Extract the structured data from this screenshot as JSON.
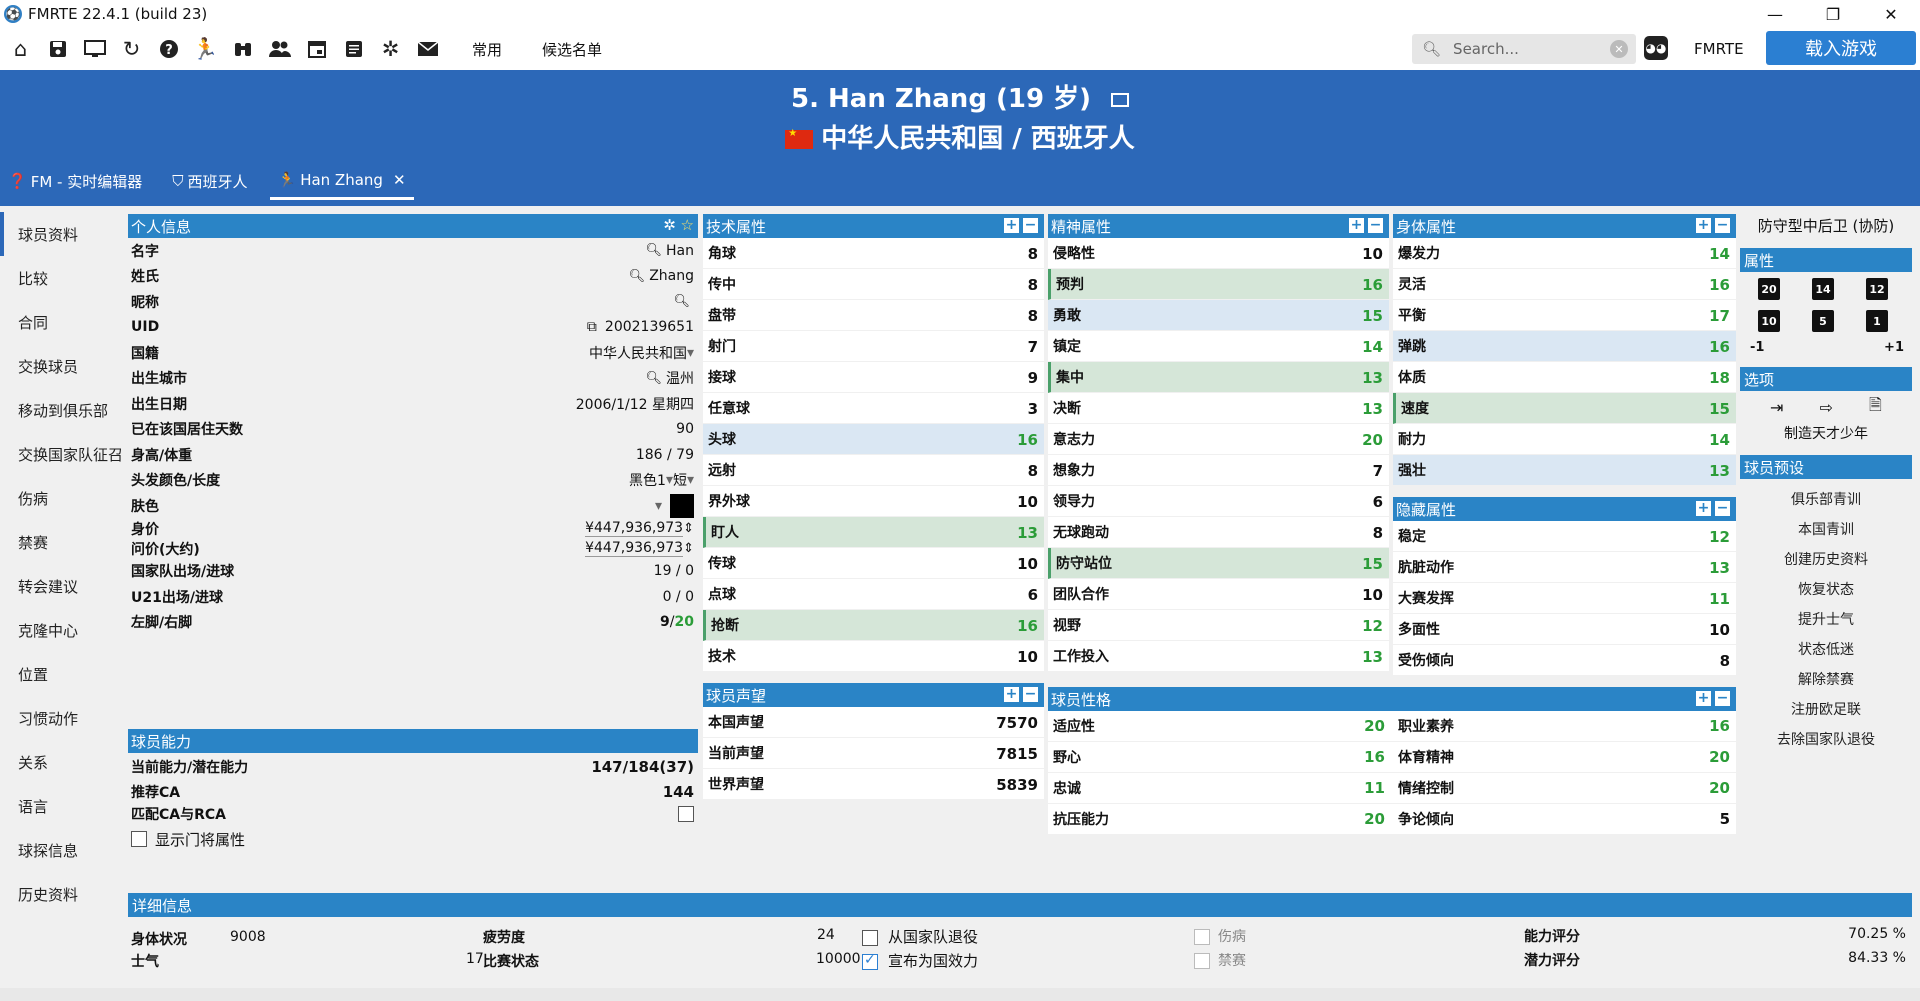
{
  "window": {
    "title": "FMRTE 22.4.1 (build 23)",
    "minimize": "—",
    "maximize": "❐",
    "close": "✕"
  },
  "toolbar": {
    "icons": [
      "home-icon",
      "save-icon",
      "monitor-icon",
      "refresh-icon",
      "help-icon",
      "player-icon",
      "binoculars-icon",
      "people-icon",
      "calendar-icon",
      "document-icon",
      "settings-icon",
      "mail-icon"
    ],
    "menu_common": "常用",
    "menu_shortlist": "候选名单",
    "search_placeholder": "Search...",
    "fmrte_label": "FMRTE",
    "load_game": "载入游戏"
  },
  "header": {
    "player_title": "5. Han Zhang (19 岁)",
    "nationality": "中华人民共和国 / 西班牙人"
  },
  "tabs": [
    {
      "label": "FM - 实时编辑器"
    },
    {
      "label": "西班牙人"
    },
    {
      "label": "Han Zhang"
    }
  ],
  "sidebar": [
    "球员资料",
    "比较",
    "合同",
    "交换球员",
    "移动到俱乐部",
    "交换国家队征召",
    "伤病",
    "禁赛",
    "转会建议",
    "克隆中心",
    "位置",
    "习惯动作",
    "关系",
    "语言",
    "球探信息",
    "历史资料"
  ],
  "personal": {
    "title": "个人信息",
    "rows": [
      {
        "label": "名字",
        "value": "Han"
      },
      {
        "label": "姓氏",
        "value": "Zhang"
      },
      {
        "label": "昵称",
        "value": ""
      },
      {
        "label": "UID",
        "value": "2002139651"
      },
      {
        "label": "国籍",
        "value": "中华人民共和国"
      },
      {
        "label": "出生城市",
        "value": "温州"
      },
      {
        "label": "出生日期",
        "value": "2006/1/12 星期四"
      },
      {
        "label": "已在该国居住天数",
        "value": "90"
      },
      {
        "label": "身高/体重",
        "value": "186 / 79"
      },
      {
        "label": "头发颜色/长度",
        "value": "黑色1",
        "value2": "短"
      },
      {
        "label": "肤色",
        "value": ""
      },
      {
        "label": "身价",
        "value": "¥447,936,973"
      },
      {
        "label": "问价(大约)",
        "value": "¥447,936,973"
      },
      {
        "label": "国家队出场/进球",
        "value": "19 / 0"
      },
      {
        "label": "U21出场/进球",
        "value": "0 / 0"
      },
      {
        "label": "左脚/右脚",
        "value": "9",
        "value2": "20"
      }
    ]
  },
  "ability": {
    "title": "球员能力",
    "ca_pa_label": "当前能力/潜在能力",
    "ca_pa": "147/184(37)",
    "rec_ca_label": "推荐CA",
    "rec_ca": "144",
    "match_label": "匹配CA与RCA",
    "show_gk_label": "显示门将属性"
  },
  "technical": {
    "title": "技术属性",
    "items": [
      {
        "label": "角球",
        "value": "8",
        "hl": ""
      },
      {
        "label": "传中",
        "value": "8",
        "hl": ""
      },
      {
        "label": "盘带",
        "value": "8",
        "hl": ""
      },
      {
        "label": "射门",
        "value": "7",
        "hl": ""
      },
      {
        "label": "接球",
        "value": "9",
        "hl": ""
      },
      {
        "label": "任意球",
        "value": "3",
        "hl": ""
      },
      {
        "label": "头球",
        "value": "16",
        "hl": "b"
      },
      {
        "label": "远射",
        "value": "8",
        "hl": ""
      },
      {
        "label": "界外球",
        "value": "10",
        "hl": ""
      },
      {
        "label": "盯人",
        "value": "13",
        "hl": "g"
      },
      {
        "label": "传球",
        "value": "10",
        "hl": ""
      },
      {
        "label": "点球",
        "value": "6",
        "hl": ""
      },
      {
        "label": "抢断",
        "value": "16",
        "hl": "g"
      },
      {
        "label": "技术",
        "value": "10",
        "hl": ""
      }
    ]
  },
  "mental": {
    "title": "精神属性",
    "items": [
      {
        "label": "侵略性",
        "value": "10",
        "hl": ""
      },
      {
        "label": "预判",
        "value": "16",
        "hl": "g"
      },
      {
        "label": "勇敢",
        "value": "15",
        "hl": "b"
      },
      {
        "label": "镇定",
        "value": "14",
        "hl": ""
      },
      {
        "label": "集中",
        "value": "13",
        "hl": "g"
      },
      {
        "label": "决断",
        "value": "13",
        "hl": ""
      },
      {
        "label": "意志力",
        "value": "20",
        "hl": ""
      },
      {
        "label": "想象力",
        "value": "7",
        "hl": ""
      },
      {
        "label": "领导力",
        "value": "6",
        "hl": ""
      },
      {
        "label": "无球跑动",
        "value": "8",
        "hl": ""
      },
      {
        "label": "防守站位",
        "value": "15",
        "hl": "g"
      },
      {
        "label": "团队合作",
        "value": "10",
        "hl": ""
      },
      {
        "label": "视野",
        "value": "12",
        "hl": ""
      },
      {
        "label": "工作投入",
        "value": "13",
        "hl": ""
      }
    ]
  },
  "physical": {
    "title": "身体属性",
    "items": [
      {
        "label": "爆发力",
        "value": "14",
        "hl": ""
      },
      {
        "label": "灵活",
        "value": "16",
        "hl": ""
      },
      {
        "label": "平衡",
        "value": "17",
        "hl": ""
      },
      {
        "label": "弹跳",
        "value": "16",
        "hl": "b"
      },
      {
        "label": "体质",
        "value": "18",
        "hl": ""
      },
      {
        "label": "速度",
        "value": "15",
        "hl": "g"
      },
      {
        "label": "耐力",
        "value": "14",
        "hl": ""
      },
      {
        "label": "强壮",
        "value": "13",
        "hl": "b"
      }
    ]
  },
  "hidden": {
    "title": "隐藏属性",
    "items": [
      {
        "label": "稳定",
        "value": "12"
      },
      {
        "label": "肮脏动作",
        "value": "13"
      },
      {
        "label": "大赛发挥",
        "value": "11"
      },
      {
        "label": "多面性",
        "value": "10"
      },
      {
        "label": "受伤倾向",
        "value": "8"
      }
    ]
  },
  "reputation": {
    "title": "球员声望",
    "items": [
      {
        "label": "本国声望",
        "value": "7570"
      },
      {
        "label": "当前声望",
        "value": "7815"
      },
      {
        "label": "世界声望",
        "value": "5839"
      }
    ]
  },
  "personality": {
    "title": "球员性格",
    "items": [
      {
        "label": "适应性",
        "value": "20",
        "label2": "职业素养",
        "value2": "16"
      },
      {
        "label": "野心",
        "value": "16",
        "label2": "体育精神",
        "value2": "20"
      },
      {
        "label": "忠诚",
        "value": "11",
        "label2": "情绪控制",
        "value2": "20"
      },
      {
        "label": "抗压能力",
        "value": "20",
        "label2": "争论倾向",
        "value2": "5"
      }
    ]
  },
  "right": {
    "position": "防守型中后卫 (协防)",
    "attr_title": "属性",
    "attr_buttons": [
      "20",
      "14",
      "12",
      "10",
      "5",
      "1"
    ],
    "minus": "-1",
    "plus": "+1",
    "options_title": "选项",
    "make_wonderkid": "制造天才少年",
    "presets_title": "球员预设",
    "presets": [
      "俱乐部青训",
      "本国青训",
      "创建历史资料",
      "恢复状态",
      "提升士气",
      "状态低迷",
      "解除禁赛",
      "注册欧足联",
      "去除国家队退役"
    ]
  },
  "details": {
    "title": "详细信息",
    "condition_label": "身体状况",
    "condition": "9008",
    "fatigue_label": "疲劳度",
    "fatigue": "24",
    "morale_label": "士气",
    "morale": "17",
    "form_label": "比赛状态",
    "form": "10000",
    "retired_label": "从国家队退役",
    "declared_label": "宣布为国效力",
    "injury_label": "伤病",
    "ban_label": "禁赛",
    "ability_rating_label": "能力评分",
    "ability_rating": "70.25 %",
    "potential_rating_label": "潜力评分",
    "potential_rating": "84.33 %"
  }
}
